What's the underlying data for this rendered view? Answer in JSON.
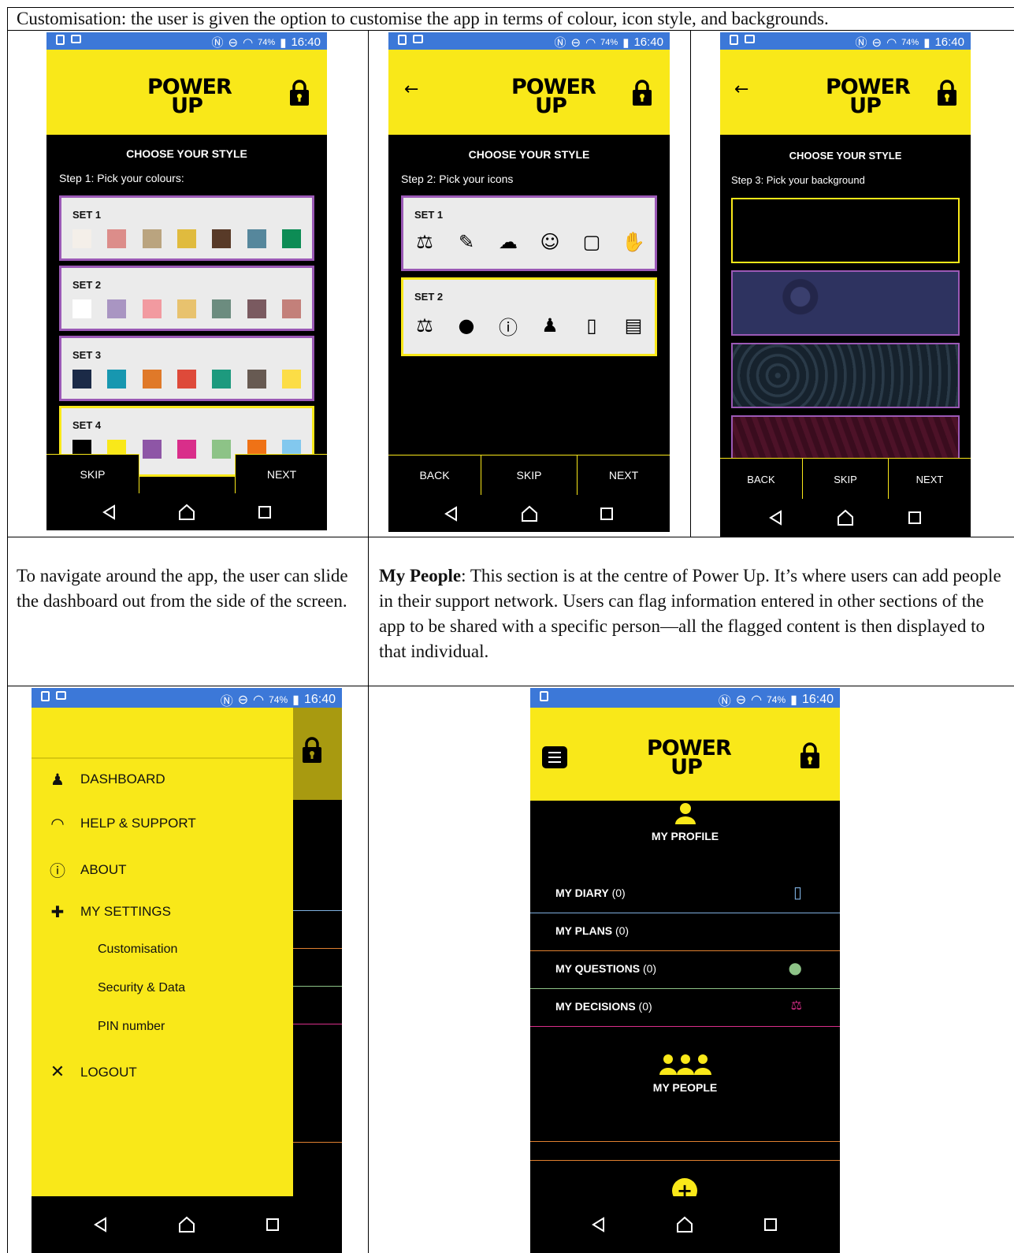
{
  "top_caption": "Customisation: the user is given the option to customise the app in terms of colour, icon style, and backgrounds.",
  "status": {
    "battery": "74%",
    "time": "16:40"
  },
  "logo": {
    "line1": "POWER",
    "line2": "UP"
  },
  "style_screen": {
    "title": "CHOOSE YOUR STYLE",
    "step1": "Step 1: Pick your colours:",
    "step2": "Step 2: Pick your icons",
    "step3": "Step 3: Pick your background",
    "color_sets": [
      {
        "label": "SET 1",
        "colors": [
          "#f4efe9",
          "#dc8d8a",
          "#baa47f",
          "#e0bb3e",
          "#583a28",
          "#56879c",
          "#0d8c55"
        ]
      },
      {
        "label": "SET 2",
        "colors": [
          "#ffffff",
          "#a995c2",
          "#f29aa0",
          "#e8c26e",
          "#6c8c7f",
          "#7a5a60",
          "#c3807a"
        ]
      },
      {
        "label": "SET 3",
        "colors": [
          "#1b2a47",
          "#1797b0",
          "#e07929",
          "#de4a3a",
          "#1d9a7e",
          "#675a52",
          "#fcdd46"
        ]
      },
      {
        "label": "SET 4",
        "colors": [
          "#000000",
          "#f9e819",
          "#8e56a6",
          "#d92e8a",
          "#8dc387",
          "#ef7216",
          "#82c8ee"
        ]
      }
    ],
    "icon_sets": [
      {
        "label": "SET 1",
        "icons": [
          "scales-outline-icon",
          "pencil-outline-icon",
          "cloud-outline-icon",
          "person-outline-icon",
          "notebook-outline-icon",
          "hand-outline-icon"
        ]
      },
      {
        "label": "SET 2",
        "icons": [
          "scales-icon",
          "chat-icon",
          "info-icon",
          "person-icon",
          "diary-icon",
          "document-icon"
        ]
      }
    ],
    "buttons": {
      "skip": "SKIP",
      "next": "NEXT",
      "back": "BACK"
    }
  },
  "caption_nav": "To navigate around the app, the user can slide the dashboard out from the side of the screen.",
  "caption_people_bold": "My People",
  "caption_people_rest": ": This section is at the centre of Power Up. It’s where users can add people in their support network. Users can flag information entered in other sections of the app to be shared with a specific person—all the flagged content is then displayed to that individual.",
  "drawer": {
    "items": [
      {
        "label": "DASHBOARD",
        "icon": "person-icon"
      },
      {
        "label": "HELP & SUPPORT",
        "icon": "rainbow-icon"
      },
      {
        "label": "ABOUT",
        "icon": "info-icon"
      },
      {
        "label": "MY SETTINGS",
        "icon": "puzzle-icon"
      }
    ],
    "subitems": [
      "Customisation",
      "Security & Data",
      "PIN number"
    ],
    "logout": "LOGOUT"
  },
  "home": {
    "profile": "MY PROFILE",
    "rows": [
      {
        "label": "MY DIARY",
        "count": "(0)",
        "color": "#7fb0e0"
      },
      {
        "label": "MY PLANS",
        "count": "(0)",
        "color": "#e08030"
      },
      {
        "label": "MY QUESTIONS",
        "count": "(0)",
        "color": "#8dc387"
      },
      {
        "label": "MY DECISIONS",
        "count": "(0)",
        "color": "#d92e8a"
      }
    ],
    "people": "MY PEOPLE"
  },
  "colors": {
    "brand_yellow": "#f9e819",
    "status_blue": "#3c78d8",
    "accent_purple": "#9b59b6"
  }
}
